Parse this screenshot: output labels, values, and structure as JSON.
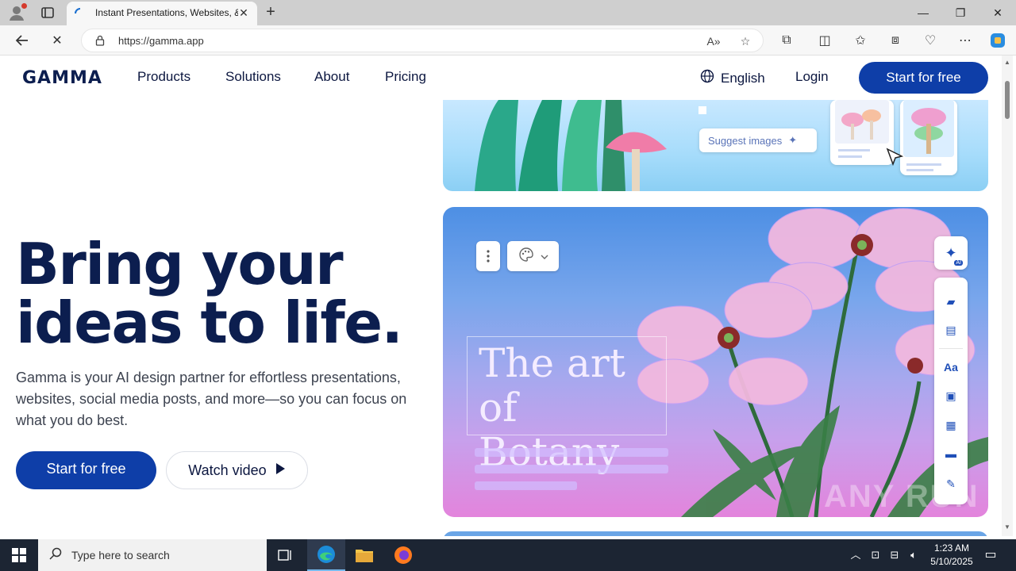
{
  "browser": {
    "tab_title": "Instant Presentations, Websites, & ...",
    "url": "https://gamma.app"
  },
  "site": {
    "logo": "GAMMA",
    "nav": [
      "Products",
      "Solutions",
      "About",
      "Pricing"
    ],
    "language": "English",
    "login": "Login",
    "cta_top": "Start for free"
  },
  "hero": {
    "title_line1": "Bring your",
    "title_line2": "ideas to life.",
    "subtitle": "Gamma is your AI design partner for effortless presentations, websites, social media posts, and more—so you can focus on what you do best.",
    "primary_button": "Start for free",
    "secondary_button": "Watch video"
  },
  "preview": {
    "suggest_images": "Suggest images",
    "heading_line1": "The art",
    "heading_line2": "of Botany",
    "ai_badge": "AI",
    "text_tool": "Aa",
    "watermark": "ANY RUN"
  },
  "taskbar": {
    "search_placeholder": "Type here to search",
    "time": "1:23 AM",
    "date": "5/10/2025"
  },
  "colors": {
    "brand": "#0e3ea8",
    "heading": "#0c1e4f",
    "taskbar": "#1c2533"
  }
}
